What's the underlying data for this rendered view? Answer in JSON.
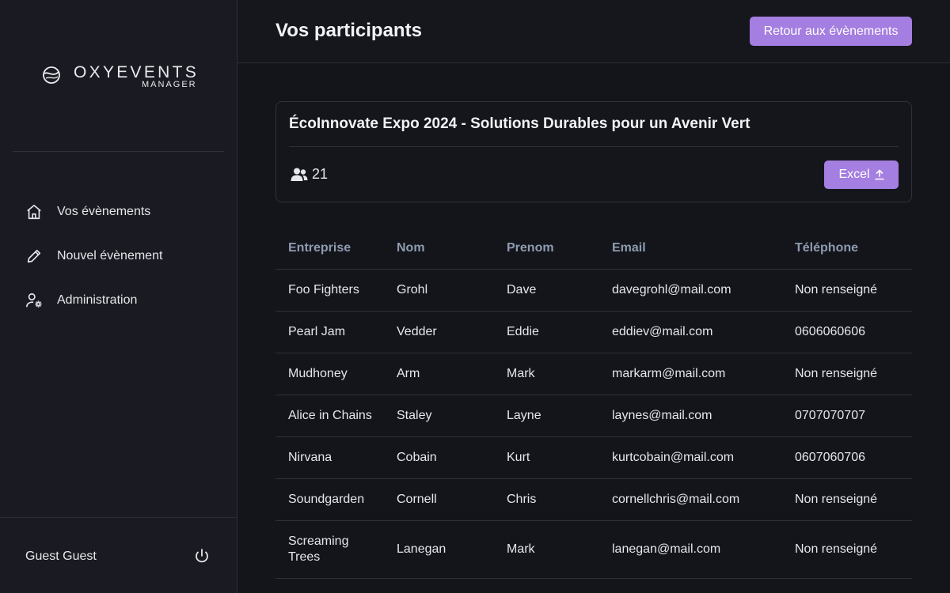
{
  "brand": {
    "name": "OXYEVENTS",
    "subtitle": "MANAGER"
  },
  "sidebar": {
    "items": [
      {
        "label": "Vos évènements",
        "icon": "home-icon"
      },
      {
        "label": "Nouvel évènement",
        "icon": "pencil-icon"
      },
      {
        "label": "Administration",
        "icon": "user-settings-icon"
      }
    ],
    "user": "Guest Guest"
  },
  "header": {
    "title": "Vos participants",
    "back_button": "Retour aux évènements"
  },
  "event": {
    "title": "ÉcoInnovate Expo 2024 - Solutions Durables pour un Avenir Vert",
    "participant_count": "21",
    "export_label": "Excel"
  },
  "table": {
    "columns": [
      "Entreprise",
      "Nom",
      "Prenom",
      "Email",
      "Téléphone"
    ],
    "rows": [
      [
        "Foo Fighters",
        "Grohl",
        "Dave",
        "davegrohl@mail.com",
        "Non renseigné"
      ],
      [
        "Pearl Jam",
        "Vedder",
        "Eddie",
        "eddiev@mail.com",
        "0606060606"
      ],
      [
        "Mudhoney",
        "Arm",
        "Mark",
        "markarm@mail.com",
        "Non renseigné"
      ],
      [
        "Alice in Chains",
        "Staley",
        "Layne",
        "laynes@mail.com",
        "0707070707"
      ],
      [
        "Nirvana",
        "Cobain",
        "Kurt",
        "kurtcobain@mail.com",
        "0607060706"
      ],
      [
        "Soundgarden",
        "Cornell",
        "Chris",
        "cornellchris@mail.com",
        "Non renseigné"
      ],
      [
        "Screaming Trees",
        "Lanegan",
        "Mark",
        "lanegan@mail.com",
        "Non renseigné"
      ]
    ]
  },
  "colors": {
    "background": "#14151b",
    "sidebar": "#1a1b22",
    "accent": "#a47ee0",
    "header_text_muted": "#8e9bb0"
  }
}
